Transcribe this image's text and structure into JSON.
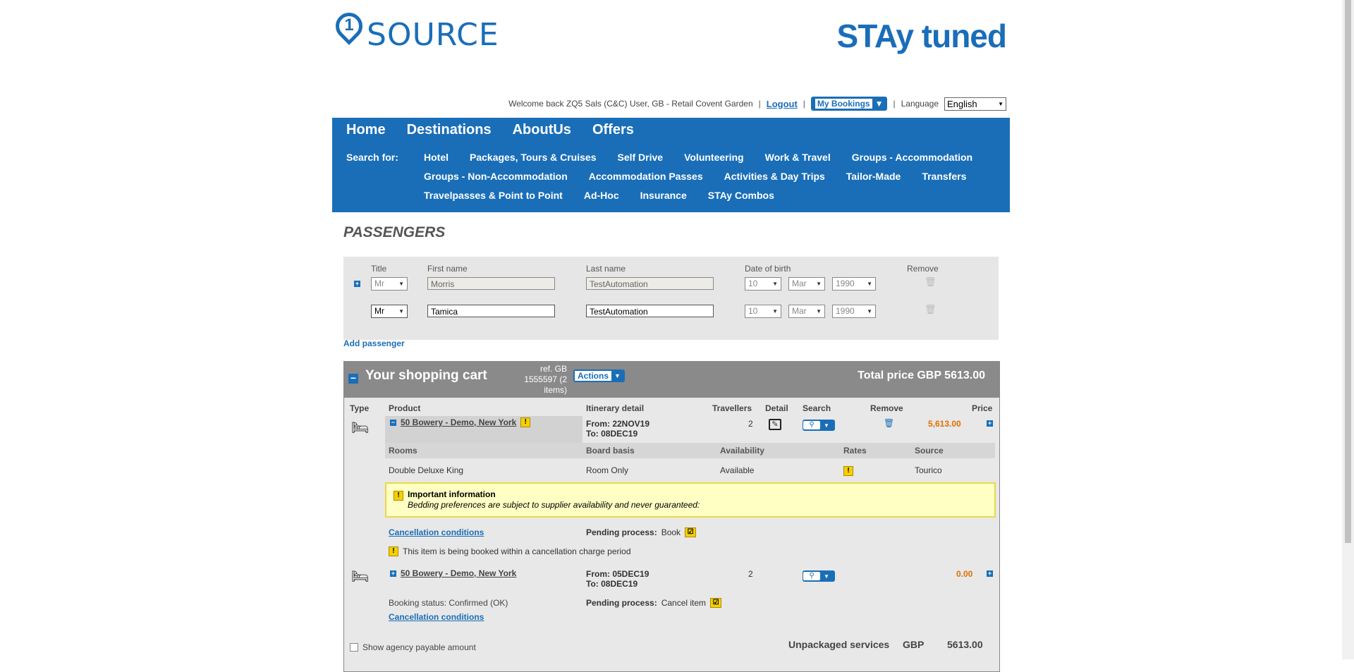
{
  "header": {
    "logo_text": "SOURCE",
    "logo_num": "1",
    "brand_text": "STAy tuned",
    "welcome": "Welcome back ZQ5 Sals (C&C) User, GB - Retail Covent Garden",
    "logout": "Logout",
    "my_bookings": "My Bookings",
    "language_label": "Language",
    "language_value": "English"
  },
  "nav": {
    "main": [
      "Home",
      "Destinations",
      "AboutUs",
      "Offers"
    ],
    "search_for": "Search for:",
    "row1": [
      "Hotel",
      "Packages, Tours & Cruises",
      "Self Drive",
      "Volunteering",
      "Work & Travel",
      "Groups - Accommodation"
    ],
    "row2": [
      "Groups - Non-Accommodation",
      "Accommodation Passes",
      "Activities & Day Trips",
      "Tailor-Made",
      "Transfers"
    ],
    "row3": [
      "Travelpasses & Point to Point",
      "Ad-Hoc",
      "Insurance",
      "STAy Combos"
    ]
  },
  "passengers": {
    "title": "PASSENGERS",
    "headers": {
      "title": "Title",
      "first": "First name",
      "last": "Last name",
      "dob": "Date of birth",
      "remove": "Remove"
    },
    "rows": [
      {
        "title": "Mr",
        "first": "Morris",
        "last": "TestAutomation",
        "day": "10",
        "month": "Mar",
        "year": "1990"
      },
      {
        "title": "Mr",
        "first": "Tamica",
        "last": "TestAutomation",
        "day": "10",
        "month": "Mar",
        "year": "1990"
      }
    ],
    "add": "Add passenger"
  },
  "cart": {
    "title": "Your shopping cart",
    "ref": "ref. GB 1555597 (2 items)",
    "actions": "Actions",
    "total": "Total price GBP 5613.00",
    "headers": {
      "type": "Type",
      "product": "Product",
      "itinerary": "Itinerary detail",
      "travellers": "Travellers",
      "detail": "Detail",
      "search": "Search",
      "remove": "Remove",
      "price": "Price"
    },
    "item1": {
      "product": "50 Bowery - Demo, New York",
      "from": "From: 22NOV19",
      "to": "To: 08DEC19",
      "travellers": "2",
      "price": "5,613.00",
      "sub_headers": {
        "rooms": "Rooms",
        "board": "Board basis",
        "avail": "Availability",
        "rates": "Rates",
        "source": "Source"
      },
      "room": "Double Deluxe King",
      "board": "Room Only",
      "availability": "Available",
      "source": "Tourico",
      "info_title": "Important information",
      "info_text": "Bedding preferences are subject to supplier availability and never guaranteed:",
      "cancel": "Cancellation conditions",
      "pending_label": "Pending process:",
      "pending_value": "Book",
      "warning": "This item is being booked within a cancellation charge period"
    },
    "item2": {
      "product": "50 Bowery - Demo, New York",
      "from": "From: 05DEC19",
      "to": "To: 08DEC19",
      "travellers": "2",
      "price": "0.00",
      "status": "Booking status: Confirmed (OK)",
      "pending_label": "Pending process:",
      "pending_value": "Cancel item",
      "cancel": "Cancellation conditions"
    },
    "show_agency": "Show agency payable amount",
    "unpackaged_label": "Unpackaged services",
    "unpackaged_cur": "GBP",
    "unpackaged_value": "5613.00"
  }
}
